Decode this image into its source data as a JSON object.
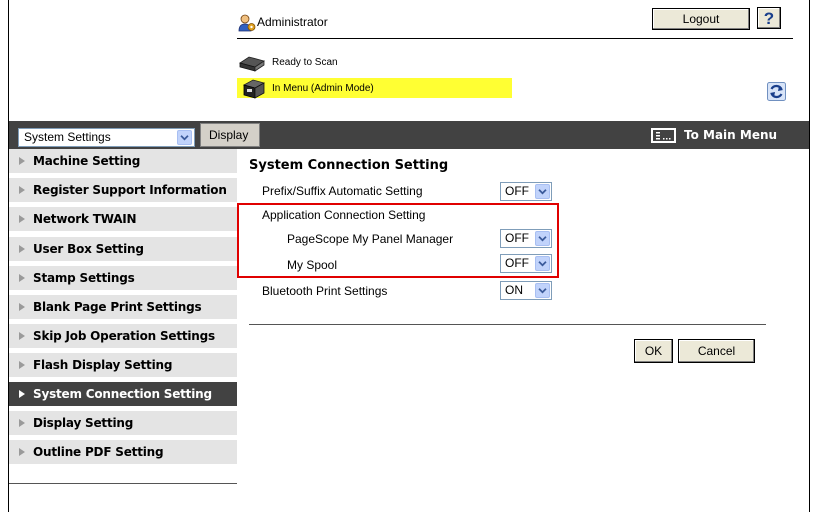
{
  "header": {
    "user_name": "Administrator",
    "logout_label": "Logout",
    "help_label": "?",
    "status_ready": "Ready to Scan",
    "status_mode": "In Menu (Admin Mode)",
    "mode_highlight_color": "#ffff33"
  },
  "toolbar": {
    "category_selected": "System Settings",
    "display_label": "Display",
    "main_menu_label": "To Main Menu"
  },
  "sidebar": {
    "items": [
      {
        "label": "Machine Setting",
        "active": false
      },
      {
        "label": "Register Support Information",
        "active": false
      },
      {
        "label": "Network TWAIN",
        "active": false
      },
      {
        "label": "User Box Setting",
        "active": false
      },
      {
        "label": "Stamp Settings",
        "active": false
      },
      {
        "label": "Blank Page Print Settings",
        "active": false
      },
      {
        "label": "Skip Job Operation Settings",
        "active": false
      },
      {
        "label": "Flash Display Setting",
        "active": false
      },
      {
        "label": "System Connection Setting",
        "active": true
      },
      {
        "label": "Display Setting",
        "active": false
      },
      {
        "label": "Outline PDF Setting",
        "active": false
      }
    ]
  },
  "main": {
    "title": "System Connection Setting",
    "rows": {
      "prefix_suffix": {
        "label": "Prefix/Suffix Automatic Setting",
        "value": "OFF"
      },
      "app_connection": {
        "label": "Application Connection Setting"
      },
      "pagescope": {
        "label": "PageScope My Panel Manager",
        "value": "OFF"
      },
      "my_spool": {
        "label": "My Spool",
        "value": "OFF"
      },
      "bluetooth": {
        "label": "Bluetooth Print Settings",
        "value": "ON"
      }
    },
    "ok_label": "OK",
    "cancel_label": "Cancel"
  },
  "colors": {
    "dark_bar": "#424242",
    "highlight_box": "#e00000"
  }
}
